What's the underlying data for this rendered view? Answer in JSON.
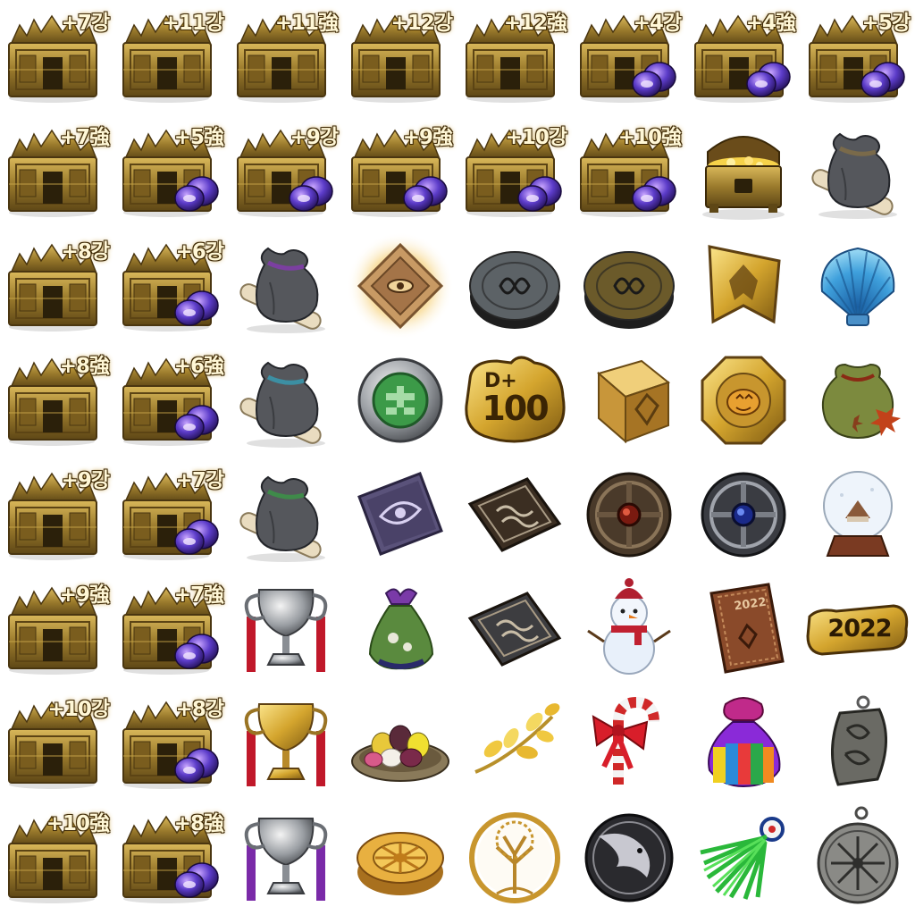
{
  "cells": [
    {
      "icon": "enhance-chest-icon",
      "label": "+7강",
      "stones": false
    },
    {
      "icon": "enhance-chest-icon",
      "label": "+11강",
      "stones": false
    },
    {
      "icon": "enhance-chest-icon",
      "label": "+11強",
      "stones": false
    },
    {
      "icon": "enhance-chest-icon",
      "label": "+12강",
      "stones": false
    },
    {
      "icon": "enhance-chest-icon",
      "label": "+12強",
      "stones": false
    },
    {
      "icon": "enhance-chest-icon",
      "label": "+4강",
      "stones": true
    },
    {
      "icon": "enhance-chest-icon",
      "label": "+4強",
      "stones": true
    },
    {
      "icon": "enhance-chest-icon",
      "label": "+5강",
      "stones": true
    },
    {
      "icon": "enhance-chest-icon",
      "label": "+7強",
      "stones": false
    },
    {
      "icon": "enhance-chest-icon",
      "label": "+5強",
      "stones": true
    },
    {
      "icon": "enhance-chest-icon",
      "label": "+9강",
      "stones": true
    },
    {
      "icon": "enhance-chest-icon",
      "label": "+9強",
      "stones": true
    },
    {
      "icon": "enhance-chest-icon",
      "label": "+10강",
      "stones": true
    },
    {
      "icon": "enhance-chest-icon",
      "label": "+10強",
      "stones": true
    },
    {
      "icon": "treasure-chest-icon"
    },
    {
      "icon": "pouch-scroll-icon",
      "tie": "#7a6a4a"
    },
    {
      "icon": "enhance-chest-icon",
      "label": "+8강",
      "stones": false
    },
    {
      "icon": "enhance-chest-icon",
      "label": "+6강",
      "stones": true
    },
    {
      "icon": "pouch-scroll-icon",
      "tie": "#7b3fa0"
    },
    {
      "icon": "glowing-rhombus-icon"
    },
    {
      "icon": "stone-disc-icon",
      "color": "#5c6266"
    },
    {
      "icon": "stone-disc-icon",
      "color": "#6b5a2a"
    },
    {
      "icon": "golden-banner-icon"
    },
    {
      "icon": "seashell-icon"
    },
    {
      "icon": "enhance-chest-icon",
      "label": "+8強",
      "stones": false
    },
    {
      "icon": "enhance-chest-icon",
      "label": "+6強",
      "stones": true
    },
    {
      "icon": "pouch-scroll-icon",
      "tie": "#3c8fa3"
    },
    {
      "icon": "jade-coin-icon"
    },
    {
      "icon": "d-plus-100-icon",
      "d1": "D+",
      "d2": "100"
    },
    {
      "icon": "golden-cube-icon"
    },
    {
      "icon": "pumpkin-coin-icon"
    },
    {
      "icon": "maple-pouch-icon"
    },
    {
      "icon": "enhance-chest-icon",
      "label": "+9강",
      "stones": false
    },
    {
      "icon": "enhance-chest-icon",
      "label": "+7강",
      "stones": true
    },
    {
      "icon": "pouch-scroll-icon",
      "tie": "#3f8a4a"
    },
    {
      "icon": "eye-tile-icon"
    },
    {
      "icon": "rune-tile-icon",
      "color": "#3b2e22"
    },
    {
      "icon": "ruby-medallion-icon"
    },
    {
      "icon": "sapphire-medallion-icon"
    },
    {
      "icon": "snow-globe-icon"
    },
    {
      "icon": "enhance-chest-icon",
      "label": "+9強",
      "stones": false
    },
    {
      "icon": "enhance-chest-icon",
      "label": "+7強",
      "stones": true
    },
    {
      "icon": "silver-trophy-icon",
      "ribbon": "#c0182a"
    },
    {
      "icon": "green-pouch-icon"
    },
    {
      "icon": "rune-tile-icon",
      "color": "#3d3d40"
    },
    {
      "icon": "snowman-icon"
    },
    {
      "icon": "leather-journal-icon",
      "year": "2022"
    },
    {
      "icon": "year-plate-icon",
      "year": "2022"
    },
    {
      "icon": "enhance-chest-icon",
      "label": "+10강",
      "stones": false
    },
    {
      "icon": "enhance-chest-icon",
      "label": "+8강",
      "stones": true
    },
    {
      "icon": "gold-trophy-icon",
      "ribbon": "#c0182a"
    },
    {
      "icon": "rice-cake-plate-icon"
    },
    {
      "icon": "golden-sprig-icon"
    },
    {
      "icon": "candy-cane-icon"
    },
    {
      "icon": "rainbow-pouch-icon"
    },
    {
      "icon": "dog-tag-icon"
    },
    {
      "icon": "enhance-chest-icon",
      "label": "+10強",
      "stones": false
    },
    {
      "icon": "enhance-chest-icon",
      "label": "+8強",
      "stones": true
    },
    {
      "icon": "silver-trophy-icon",
      "ribbon": "#7a2aa8"
    },
    {
      "icon": "sun-cake-icon"
    },
    {
      "icon": "tree-of-life-coin-icon"
    },
    {
      "icon": "raven-coin-icon"
    },
    {
      "icon": "tinsel-pompom-icon"
    },
    {
      "icon": "rune-pendant-icon"
    }
  ]
}
